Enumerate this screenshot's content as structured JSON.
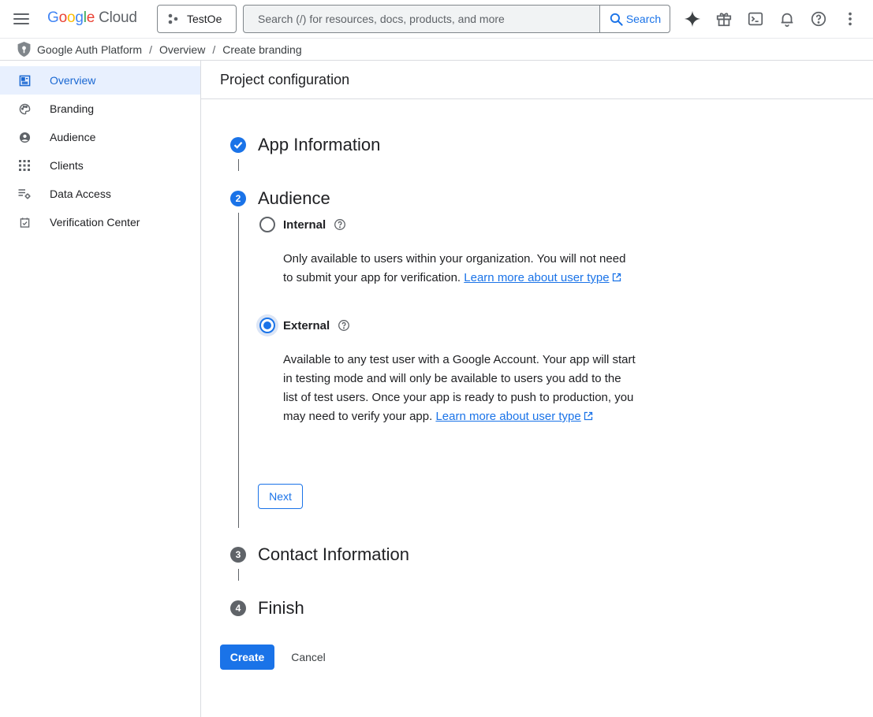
{
  "topbar": {
    "logo": {
      "g": "G",
      "o1": "o",
      "o2": "o",
      "g2": "g",
      "l": "l",
      "e": "e",
      "cloud": "Cloud"
    },
    "project_name": "TestOe",
    "search_placeholder": "Search (/) for resources, docs, products, and more",
    "search_button": "Search",
    "icons": [
      "gemini-icon",
      "gift-icon",
      "cloud-shell-icon",
      "notifications-icon",
      "help-icon",
      "more-vert-icon"
    ]
  },
  "breadcrumb": {
    "items": [
      "Google Auth Platform",
      "Overview",
      "Create branding"
    ],
    "separator": "/"
  },
  "sidebar": {
    "items": [
      {
        "label": "Overview",
        "icon": "dashboard-icon",
        "active": true
      },
      {
        "label": "Branding",
        "icon": "palette-icon",
        "active": false
      },
      {
        "label": "Audience",
        "icon": "person-icon",
        "active": false
      },
      {
        "label": "Clients",
        "icon": "apps-grid-icon",
        "active": false
      },
      {
        "label": "Data Access",
        "icon": "data-access-icon",
        "active": false
      },
      {
        "label": "Verification Center",
        "icon": "verification-icon",
        "active": false
      }
    ]
  },
  "main": {
    "title": "Project configuration",
    "steps": [
      {
        "number": "1",
        "title": "App Information",
        "state": "done"
      },
      {
        "number": "2",
        "title": "Audience",
        "state": "current"
      },
      {
        "number": "3",
        "title": "Contact Information",
        "state": "pending"
      },
      {
        "number": "4",
        "title": "Finish",
        "state": "pending"
      }
    ],
    "audience": {
      "options": [
        {
          "label": "Internal",
          "checked": false,
          "description": "Only available to users within your organization. You will not need to submit your app for verification.",
          "link": "Learn more about user type"
        },
        {
          "label": "External",
          "checked": true,
          "description": "Available to any test user with a Google Account. Your app will start in testing mode and will only be available to users you add to the list of test users. Once your app is ready to push to production, you may need to verify your app.",
          "link": "Learn more about user type"
        }
      ],
      "next_button": "Next"
    },
    "create_button": "Create",
    "cancel_button": "Cancel"
  },
  "colors": {
    "accent": "#1a73e8",
    "active_bg": "#e8f0fe",
    "border": "#dadce0"
  }
}
